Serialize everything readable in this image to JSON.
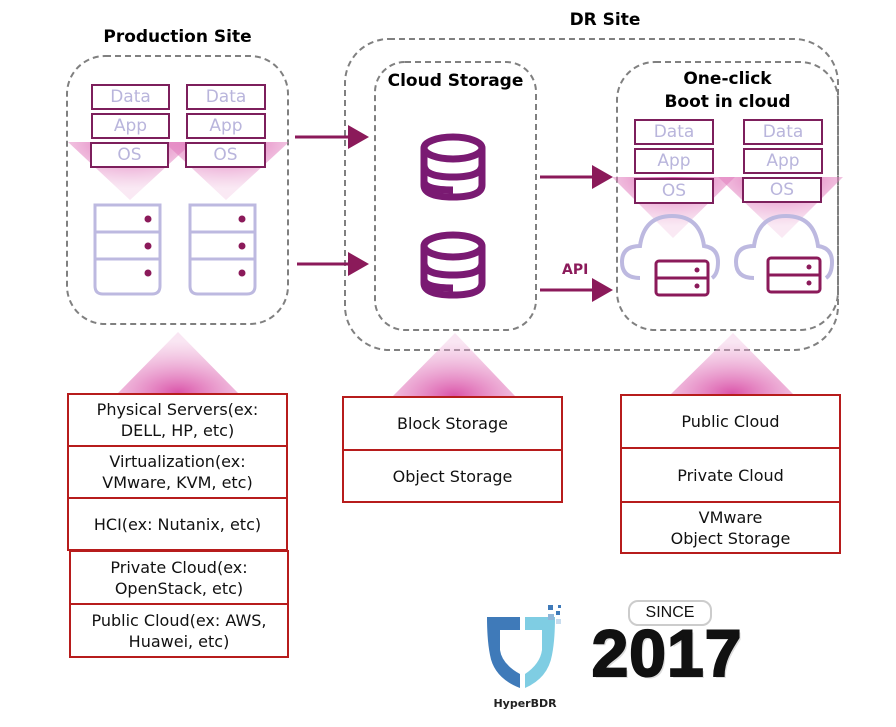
{
  "production_site": {
    "title": "Production Site",
    "servers": [
      {
        "layers": [
          "Data",
          "App",
          "OS"
        ]
      },
      {
        "layers": [
          "Data",
          "App",
          "OS"
        ]
      }
    ],
    "sources": [
      "Physical Servers(ex:\nDELL, HP, etc)",
      "Virtualization(ex:\nVMware, KVM, etc)",
      "HCI(ex: Nutanix, etc)",
      "Private Cloud(ex:\nOpenStack, etc)",
      "Public Cloud(ex: AWS,\nHuawei, etc)"
    ]
  },
  "dr_site": {
    "title": "DR Site",
    "cloud_storage": {
      "title": "Cloud Storage",
      "types": [
        "Block Storage",
        "Object Storage"
      ]
    },
    "boot": {
      "title_line1": "One-click",
      "title_line2": "Boot in cloud",
      "servers": [
        {
          "layers": [
            "Data",
            "App",
            "OS"
          ]
        },
        {
          "layers": [
            "Data",
            "App",
            "OS"
          ]
        }
      ],
      "targets": [
        "Public Cloud",
        "Private Cloud",
        "VMware\nObject Storage"
      ]
    },
    "api_label": "API"
  },
  "branding": {
    "logo_name": "HyperBDR",
    "since_label": "SINCE",
    "since_year": "2017"
  },
  "colors": {
    "accent": "#7d1f5c",
    "storage_icon": "#7a1a72",
    "layer_text": "#b9b5dc",
    "server_outline": "#bdb9e0",
    "stack_border": "#b71c1c",
    "funnel": "#d6409f",
    "dashed": "#808080"
  }
}
